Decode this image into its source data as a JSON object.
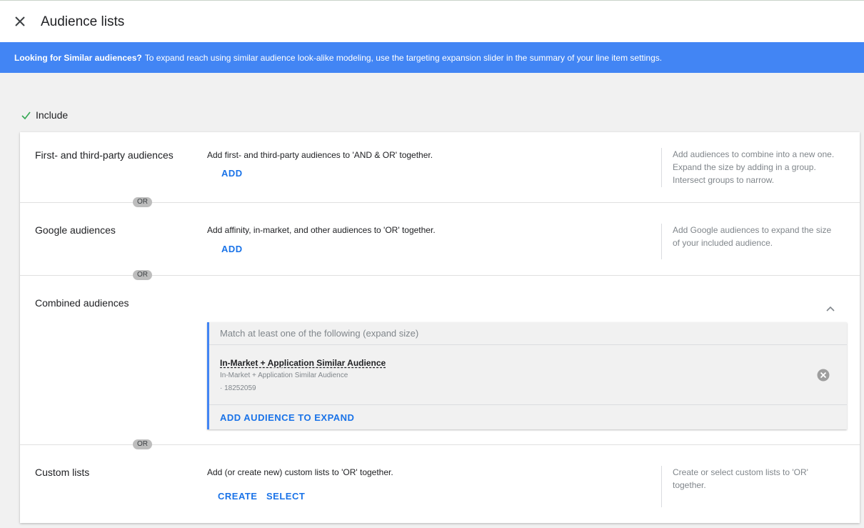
{
  "header": {
    "title": "Audience lists"
  },
  "banner": {
    "bold": "Looking for Similar audiences?",
    "text": "To expand reach using similar audience look-alike modeling, use the targeting expansion slider in the summary of your line item settings."
  },
  "include": {
    "label": "Include"
  },
  "or_label": "OR",
  "sections": {
    "first_party": {
      "title": "First- and third-party audiences",
      "desc": "Add first- and third-party audiences to 'AND & OR' together.",
      "add": "ADD",
      "help": "Add audiences to combine into a new one. Expand the size by adding in a group. Intersect groups to narrow."
    },
    "google": {
      "title": "Google audiences",
      "desc": "Add affinity, in-market, and other audiences to 'OR' together.",
      "add": "ADD",
      "help": "Add Google audiences to expand the size of your included audience."
    },
    "combined": {
      "title": "Combined audiences",
      "group_header": "Match at least one of the following (expand size)",
      "audience": {
        "name": "In-Market + Application Similar Audience",
        "sub": "In-Market + Application Similar Audience",
        "id": "· 18252059"
      },
      "add_expand": "ADD AUDIENCE TO EXPAND"
    },
    "custom": {
      "title": "Custom lists",
      "desc": "Add (or create new) custom lists to 'OR' together.",
      "create": "CREATE",
      "select": "SELECT",
      "help": "Create or select custom lists to 'OR' together."
    }
  },
  "colors": {
    "accent": "#4285f4",
    "link": "#1a73e8",
    "check": "#34a853"
  }
}
